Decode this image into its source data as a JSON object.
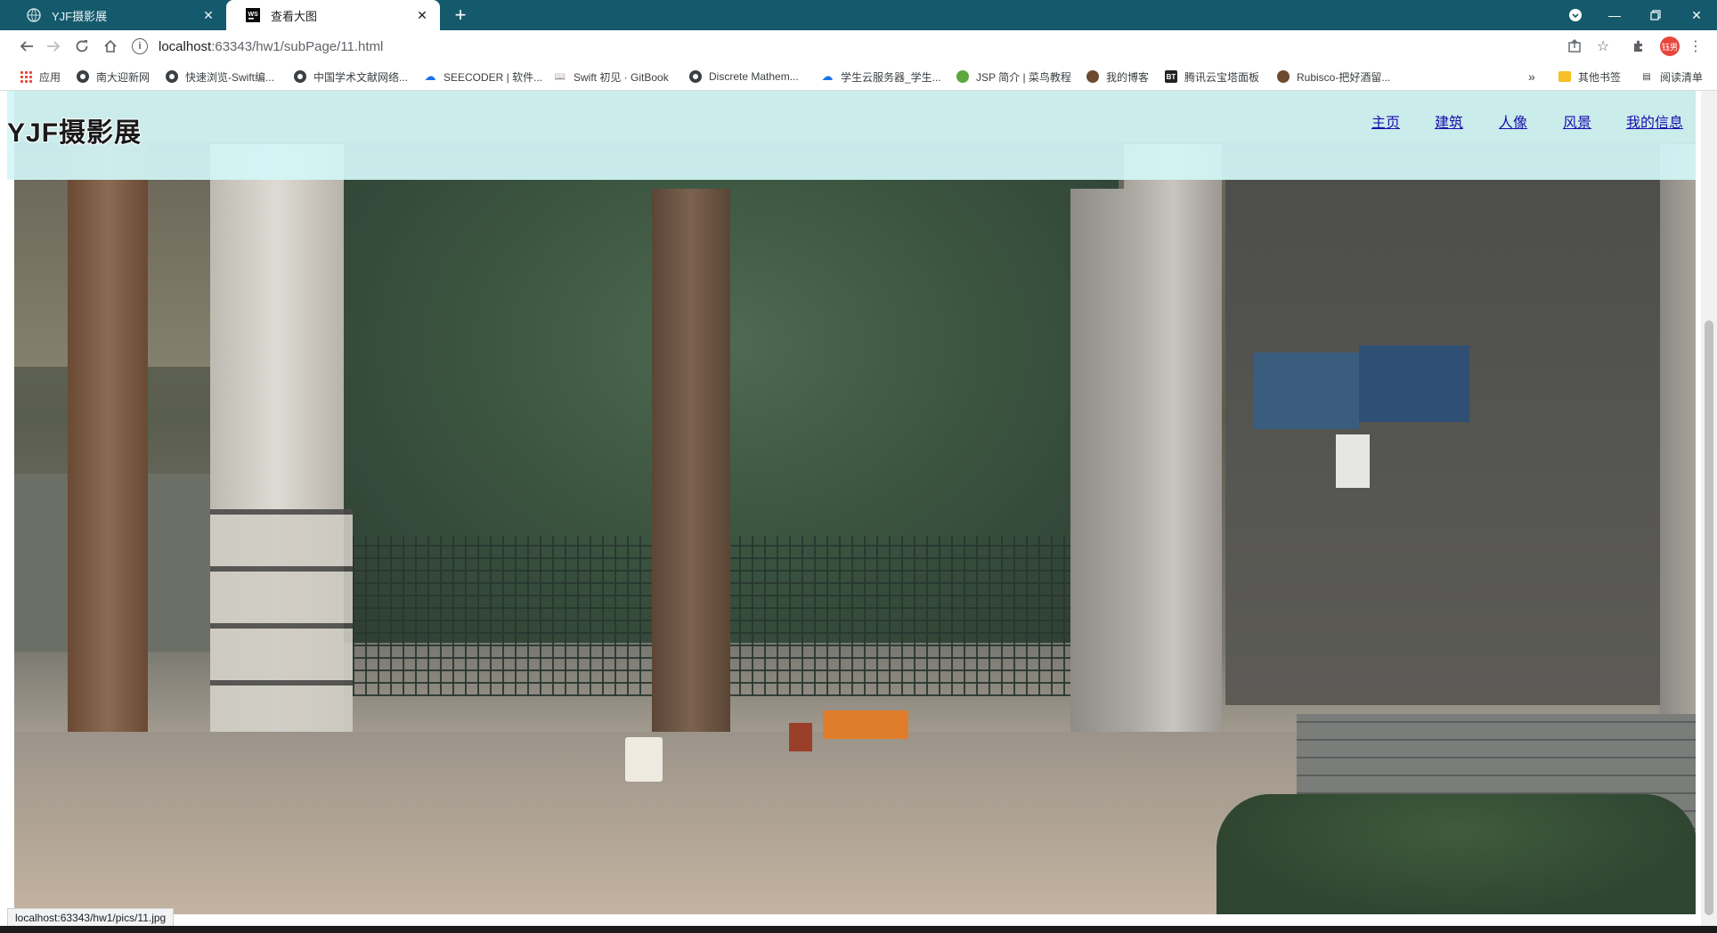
{
  "browser": {
    "tabs": [
      {
        "title": "YJF摄影展",
        "active": false
      },
      {
        "title": "查看大图",
        "active": true
      }
    ],
    "new_tab": "+",
    "url_host": "localhost",
    "url_rest": ":63343/hw1/subPage/11.html",
    "profile_label": "钰男",
    "bookmarks_overflow": "»",
    "bookmarks": [
      {
        "label": "应用",
        "icon": "apps-icon"
      },
      {
        "label": "南大迎新网",
        "icon": "globe-icon"
      },
      {
        "label": "快速浏览-Swift编...",
        "icon": "globe-icon"
      },
      {
        "label": "中国学术文献网络...",
        "icon": "globe-icon"
      },
      {
        "label": "SEECODER | 软件...",
        "icon": "cloud-icon"
      },
      {
        "label": "Swift 初见 · GitBook",
        "icon": "book-icon"
      },
      {
        "label": "Discrete Mathem...",
        "icon": "globe-icon"
      },
      {
        "label": "学生云服务器_学生...",
        "icon": "cloud-icon"
      },
      {
        "label": "JSP 简介 | 菜鸟教程",
        "icon": "runoob-icon"
      },
      {
        "label": "我的博客",
        "icon": "avatar-icon"
      },
      {
        "label": "腾讯云宝塔面板",
        "icon": "bt-icon"
      },
      {
        "label": "Rubisco-把好酒留...",
        "icon": "avatar-icon"
      }
    ],
    "other_bookmarks": "其他书签",
    "reading_list": "阅读清单",
    "status_url": "localhost:63343/hw1/pics/11.jpg"
  },
  "site": {
    "brand": "YJF摄影展",
    "nav": [
      "主页",
      "建筑",
      "人像",
      "风景",
      "我的信息"
    ]
  },
  "colors": {
    "tab_strip": "#155a6c",
    "header_overlay": "#d2f6f6",
    "link": "#1a0dab"
  }
}
